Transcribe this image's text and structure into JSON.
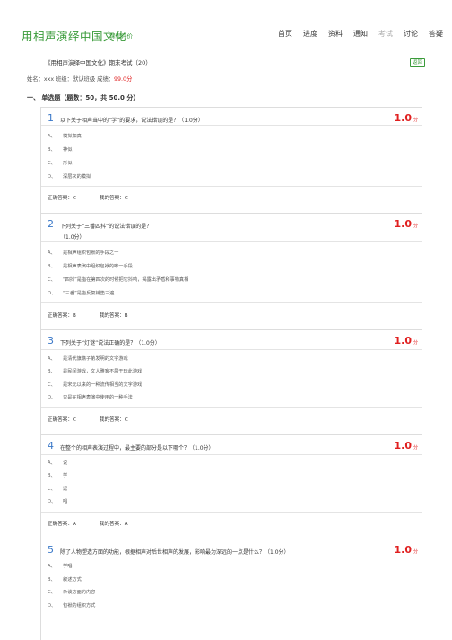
{
  "header": {
    "course_title": "用相声演绎中国文化",
    "course_sub": "课程评价",
    "nav": [
      "首页",
      "进度",
      "资料",
      "通知",
      "考试",
      "讨论",
      "答疑"
    ]
  },
  "exam": {
    "title": "《用相声演绎中国文化》期末考试（20）",
    "back_label": "返回",
    "info_prefix": "姓名：xxx   班级：默认班级   成绩：",
    "score": "99.0分",
    "section": "一、 单选题（题数：50，共 50.0 分）"
  },
  "questions": [
    {
      "num": "1",
      "text": "以下关于相声当中的“学”的要求，说法错误的是？（1.0分）",
      "score": "1.0",
      "unit": "分",
      "options": [
        {
          "l": "A、",
          "t": "模拟如真"
        },
        {
          "l": "B、",
          "t": "神似"
        },
        {
          "l": "C、",
          "t": "形似"
        },
        {
          "l": "D、",
          "t": "深层次的模拟"
        }
      ],
      "correct": "正确答案：C",
      "mine": "我的答案：C"
    },
    {
      "num": "2",
      "text": "下列关于“三番四抖”的说法错误的是？",
      "text2": "（1.0分）",
      "score": "1.0",
      "unit": "分",
      "options": [
        {
          "l": "A、",
          "t": "是相声组织包袱的手段之一"
        },
        {
          "l": "B、",
          "t": "是相声表演中组织包袱的唯一手段"
        },
        {
          "l": "C、",
          "t": "“四抖”是指在第四次的时候把它抖响，揭露出矛盾和事物真相"
        },
        {
          "l": "D、",
          "t": "“三番”是指反复铺垫三遍"
        }
      ],
      "correct": "正确答案：B",
      "mine": "我的答案：B"
    },
    {
      "num": "3",
      "text": "下列关于“灯谜”说法正确的是？（1.0分）",
      "score": "1.0",
      "unit": "分",
      "options": [
        {
          "l": "A、",
          "t": "是清代旗籍子弟发明的文字游戏"
        },
        {
          "l": "B、",
          "t": "是民间游戏，文人雅客不屑于玩此游戏"
        },
        {
          "l": "C、",
          "t": "是宋元以来的一种流传相当的文字游戏"
        },
        {
          "l": "D、",
          "t": "只是在相声表演中使用的一种手法"
        }
      ],
      "correct": "正确答案：C",
      "mine": "我的答案：C"
    },
    {
      "num": "4",
      "text": "在整个的相声表演过程中，最主要的部分是以下哪个？（1.0分）",
      "score": "1.0",
      "unit": "分",
      "options": [
        {
          "l": "A、",
          "t": "说"
        },
        {
          "l": "B、",
          "t": "学"
        },
        {
          "l": "C、",
          "t": "逗"
        },
        {
          "l": "D、",
          "t": "唱"
        }
      ],
      "correct": "正确答案：A",
      "mine": "我的答案：A"
    },
    {
      "num": "5",
      "text": "除了人物塑造方面的功能，根据相声对后世相声的发展，影响最为深远的一点是什么？（1.0分）",
      "score": "1.0",
      "unit": "分",
      "options": [
        {
          "l": "A、",
          "t": "学唱"
        },
        {
          "l": "B、",
          "t": "叙述方式"
        },
        {
          "l": "C、",
          "t": "杂谈方面的内容"
        },
        {
          "l": "D、",
          "t": "包袱的组织方式"
        }
      ],
      "correct": "",
      "mine": ""
    }
  ]
}
